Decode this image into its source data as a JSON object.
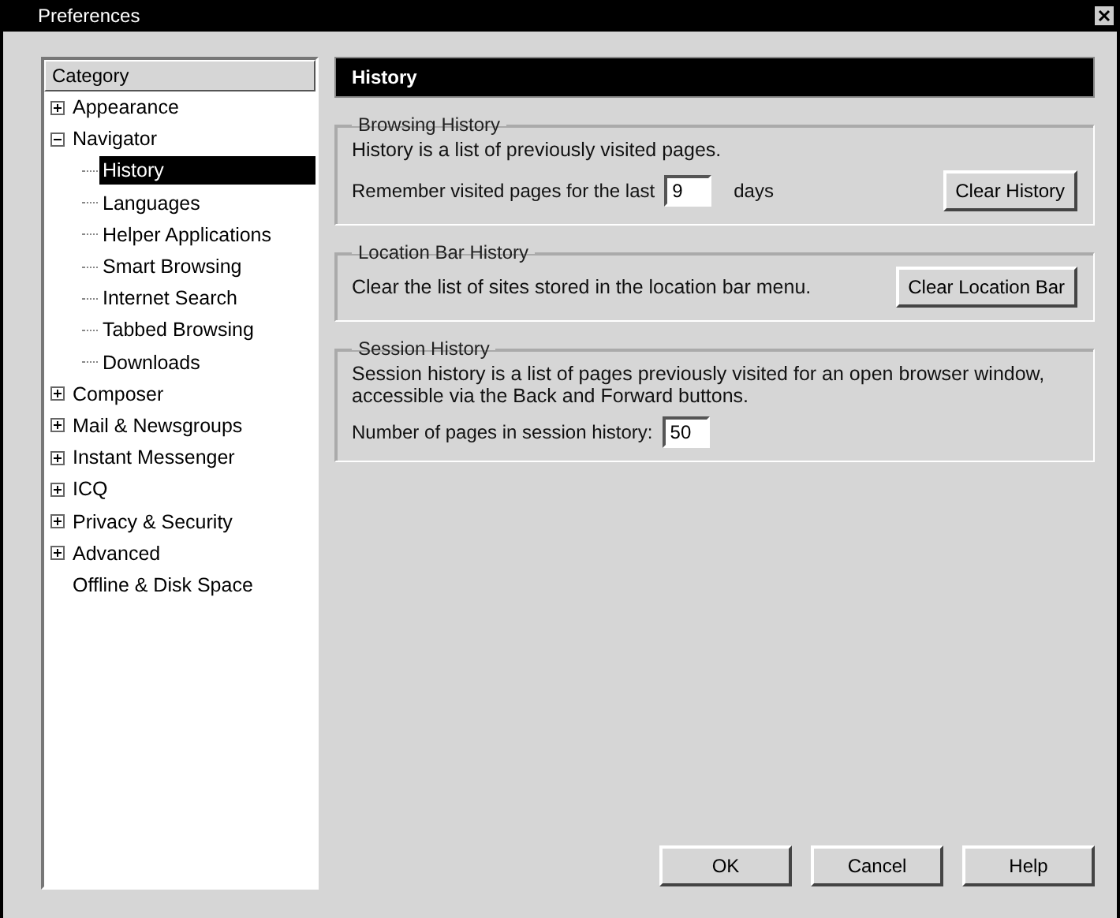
{
  "window": {
    "title": "Preferences"
  },
  "sidebar": {
    "header": "Category",
    "items": [
      {
        "label": "Appearance",
        "expanded": false,
        "selected": false
      },
      {
        "label": "Navigator",
        "expanded": true,
        "selected": false,
        "children": [
          {
            "label": "History",
            "selected": true
          },
          {
            "label": "Languages",
            "selected": false
          },
          {
            "label": "Helper Applications",
            "selected": false
          },
          {
            "label": "Smart Browsing",
            "selected": false
          },
          {
            "label": "Internet Search",
            "selected": false
          },
          {
            "label": "Tabbed Browsing",
            "selected": false
          },
          {
            "label": "Downloads",
            "selected": false
          }
        ]
      },
      {
        "label": "Composer",
        "expanded": false,
        "selected": false
      },
      {
        "label": "Mail & Newsgroups",
        "expanded": false,
        "selected": false
      },
      {
        "label": "Instant Messenger",
        "expanded": false,
        "selected": false
      },
      {
        "label": "ICQ",
        "expanded": false,
        "selected": false
      },
      {
        "label": "Privacy & Security",
        "expanded": false,
        "selected": false
      },
      {
        "label": "Advanced",
        "expanded": false,
        "selected": false
      },
      {
        "label": "Offline & Disk Space",
        "selected": false
      }
    ]
  },
  "panel": {
    "title": "History",
    "groups": [
      {
        "title": "Browsing History",
        "description": "History is a list of previously visited pages.",
        "field": {
          "label": "Remember visited pages for the last",
          "value": "9",
          "suffix": "days"
        },
        "button": "Clear History"
      },
      {
        "title": "Location Bar History",
        "description": "Clear the list of sites stored in the location bar menu.",
        "button": "Clear Location Bar"
      },
      {
        "title": "Session History",
        "description": "Session history is a list of pages previously visited for an open browser window, accessible via the Back and Forward buttons.",
        "field": {
          "label": "Number of pages in session history:",
          "value": "50"
        }
      }
    ]
  },
  "buttons": [
    "OK",
    "Cancel",
    "Help"
  ]
}
